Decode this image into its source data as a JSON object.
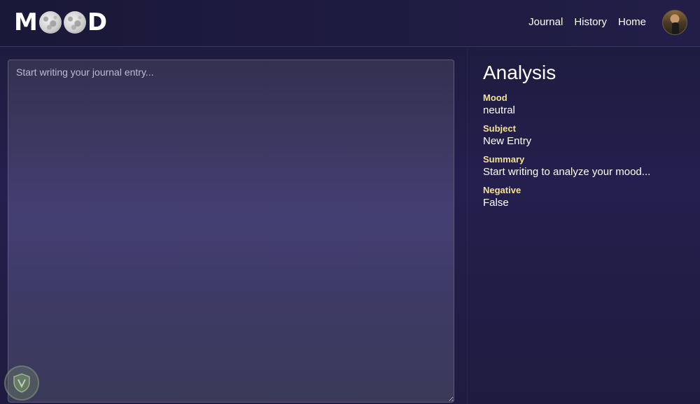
{
  "app": {
    "logo_left": "M",
    "logo_right": "D"
  },
  "nav": {
    "links": [
      "Journal",
      "History",
      "Home"
    ]
  },
  "editor": {
    "placeholder": "Start writing your journal entry...",
    "value": ""
  },
  "analysis": {
    "title": "Analysis",
    "fields": [
      {
        "label": "Mood",
        "value": "neutral"
      },
      {
        "label": "Subject",
        "value": "New Entry"
      },
      {
        "label": "Summary",
        "value": "Start writing to analyze your mood..."
      },
      {
        "label": "Negative",
        "value": "False"
      }
    ]
  },
  "colors": {
    "label_accent": "#f4e38a",
    "background": "#241f4d"
  },
  "icons": {
    "logo_moons": "moon-icon",
    "avatar": "avatar",
    "watermark": "shield-icon"
  }
}
